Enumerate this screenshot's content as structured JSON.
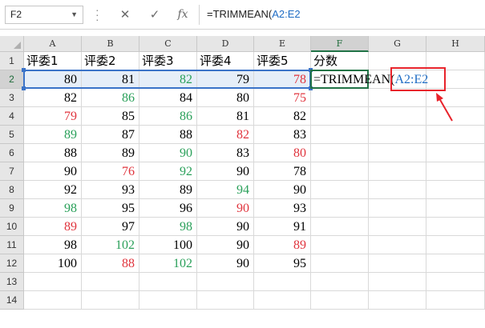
{
  "formula_bar": {
    "name_box": "F2",
    "cancel_glyph": "✕",
    "enter_glyph": "✓",
    "fx_label": "fx",
    "formula_prefix": "=TRIMMEAN(",
    "formula_ref": "A2:E2"
  },
  "columns": [
    "A",
    "B",
    "C",
    "D",
    "E",
    "F",
    "G",
    "H"
  ],
  "rows": [
    "1",
    "2",
    "3",
    "4",
    "5",
    "6",
    "7",
    "8",
    "9",
    "10",
    "11",
    "12",
    "13",
    "14"
  ],
  "header_row": [
    "评委1",
    "评委2",
    "评委3",
    "评委4",
    "评委5",
    "分数"
  ],
  "data_rows": [
    [
      80,
      81,
      82,
      79,
      78
    ],
    [
      82,
      86,
      84,
      80,
      75
    ],
    [
      79,
      85,
      86,
      81,
      82
    ],
    [
      89,
      87,
      88,
      82,
      83
    ],
    [
      88,
      89,
      90,
      83,
      80
    ],
    [
      90,
      76,
      92,
      90,
      78
    ],
    [
      92,
      93,
      89,
      94,
      90
    ],
    [
      98,
      95,
      96,
      90,
      93
    ],
    [
      89,
      97,
      98,
      90,
      91
    ],
    [
      98,
      102,
      100,
      90,
      89
    ],
    [
      100,
      88,
      102,
      90,
      95
    ]
  ],
  "data_colors": [
    [
      "black",
      "black",
      "green",
      "black",
      "red"
    ],
    [
      "black",
      "green",
      "black",
      "black",
      "red"
    ],
    [
      "red",
      "black",
      "green",
      "black",
      "black"
    ],
    [
      "green",
      "black",
      "black",
      "red",
      "black"
    ],
    [
      "black",
      "black",
      "green",
      "black",
      "red"
    ],
    [
      "black",
      "red",
      "green",
      "black",
      "black"
    ],
    [
      "black",
      "black",
      "black",
      "green",
      "black"
    ],
    [
      "green",
      "black",
      "black",
      "red",
      "black"
    ],
    [
      "red",
      "black",
      "green",
      "black",
      "black"
    ],
    [
      "black",
      "green",
      "black",
      "black",
      "red"
    ],
    [
      "black",
      "red",
      "green",
      "black",
      "black"
    ]
  ],
  "colors": {
    "black": "#000000",
    "green": "#2aa05a",
    "red": "#e0343d",
    "selection_border": "#3b73c8",
    "active_border": "#217346",
    "callout": "#e8232b"
  },
  "editing": {
    "cell": "F2",
    "prefix": "=TRIMMEAN(",
    "ref": "A2:E2"
  },
  "icons": {
    "cancel": "close-icon",
    "enter": "check-icon",
    "function": "fx-icon",
    "callout_arrow": "arrow-icon"
  }
}
